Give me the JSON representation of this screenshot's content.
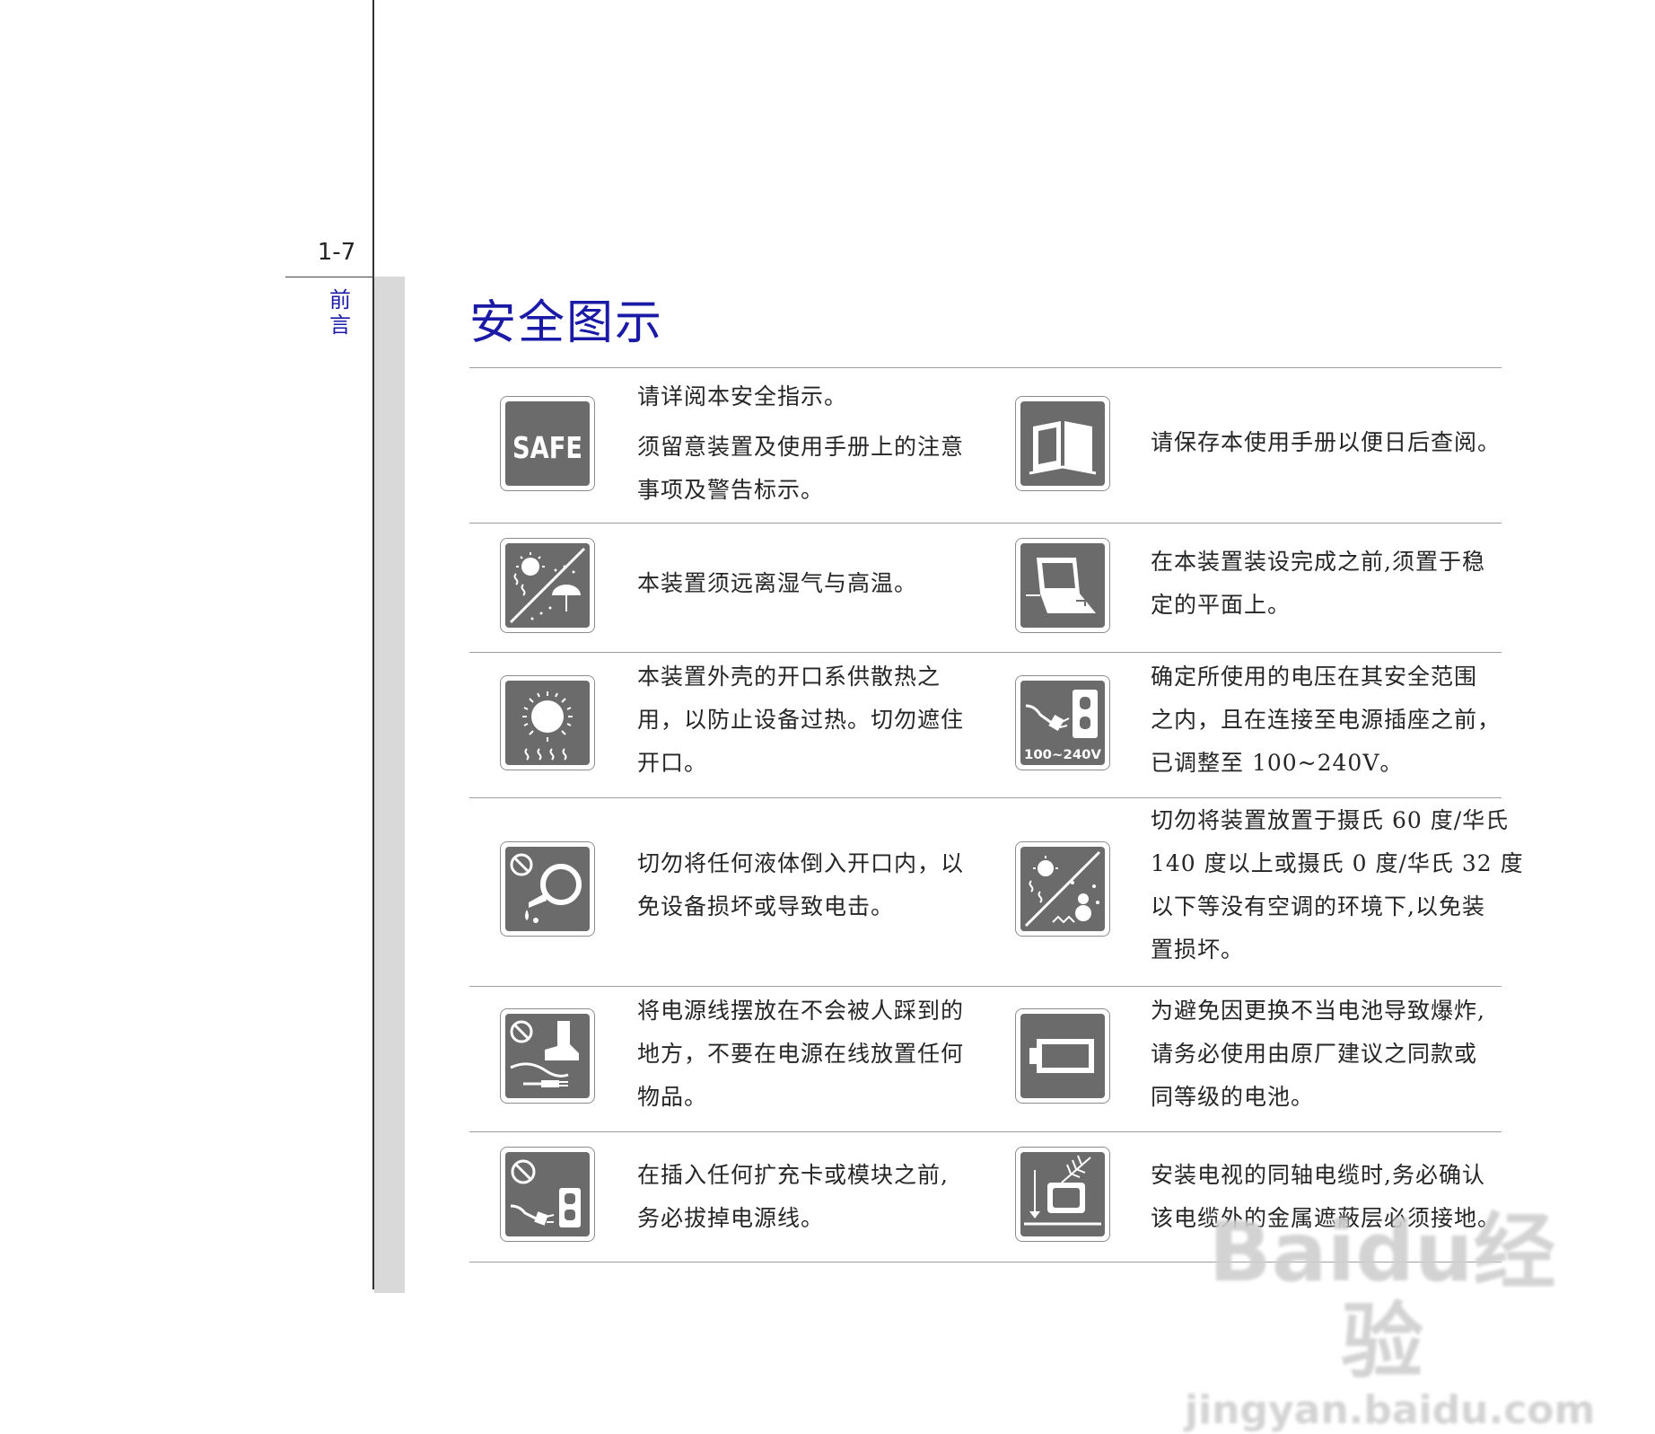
{
  "page": {
    "number": "1-7",
    "section": "前言"
  },
  "title": "安全图示",
  "items": [
    {
      "icon": "safe-icon",
      "icon_text": "SAFE",
      "lines": [
        "请详阅本安全指示。",
        "须留意装置及使用手册上的注意",
        "事项及警告标示。"
      ]
    },
    {
      "icon": "manual-book-icon",
      "lines": [
        "请保存本使用手册以便日后查阅。"
      ]
    },
    {
      "icon": "humidity-heat-icon",
      "lines": [
        "本装置须远离湿气与高温。"
      ]
    },
    {
      "icon": "flat-surface-laptop-icon",
      "lines": [
        "在本装置装设完成之前,须置于稳",
        "定的平面上。"
      ]
    },
    {
      "icon": "ventilation-heat-icon",
      "lines": [
        "本装置外壳的开口系供散热之",
        "用，以防止设备过热。切勿遮住",
        "开口。"
      ]
    },
    {
      "icon": "voltage-outlet-icon",
      "icon_text": "100~240V",
      "lines": [
        "确定所使用的电压在其安全范围",
        "之内，且在连接至电源插座之前，",
        "已调整至 100~240V。"
      ]
    },
    {
      "icon": "no-liquid-icon",
      "lines": [
        "切勿将任何液体倒入开口内，以",
        "免设备损坏或导致电击。"
      ]
    },
    {
      "icon": "temperature-range-icon",
      "lines": [
        "切勿将装置放置于摄氏 60 度/华氏",
        "140 度以上或摄氏 0 度/华氏 32 度",
        "以下等没有空调的环境下,以免装",
        "置损坏。"
      ]
    },
    {
      "icon": "no-step-on-cord-icon",
      "lines": [
        "将电源线摆放在不会被人踩到的",
        "地方，不要在电源在线放置任何",
        "物品。"
      ]
    },
    {
      "icon": "battery-icon",
      "lines": [
        "为避免因更换不当电池导致爆炸,",
        "请务必使用由原厂建议之同款或",
        "同等级的电池。"
      ]
    },
    {
      "icon": "unplug-power-icon",
      "lines": [
        "在插入任何扩充卡或模块之前,",
        "务必拔掉电源线。"
      ]
    },
    {
      "icon": "tv-antenna-ground-icon",
      "lines": [
        "安装电视的同轴电缆时,务必确认",
        "该电缆外的金属遮蔽层必须接地。"
      ]
    }
  ],
  "watermark": {
    "brand": "Baidu经验",
    "url": "jingyan.baidu.com"
  }
}
